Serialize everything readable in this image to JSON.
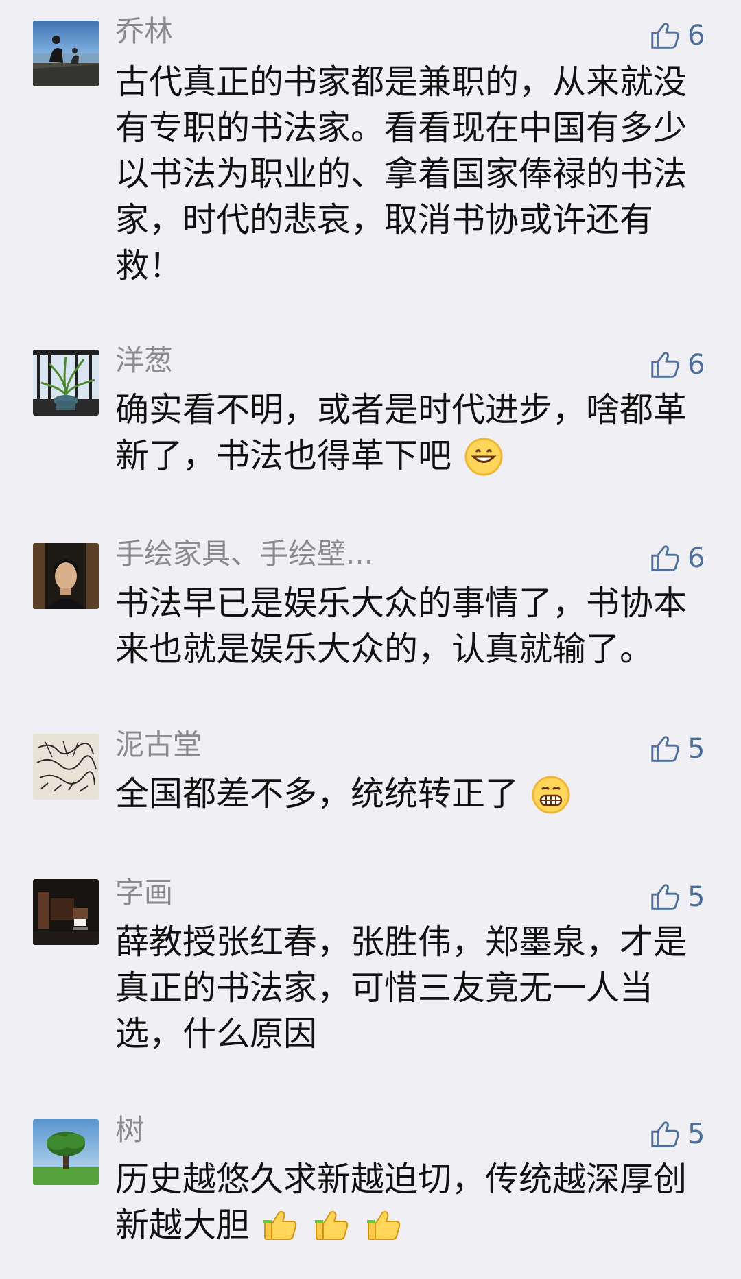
{
  "comments": [
    {
      "author": "乔林",
      "likes": "6",
      "text": "古代真正的书家都是兼职的，从来就没有专职的书法家。看看现在中国有多少以书法为职业的、拿着国家俸禄的书法家，时代的悲哀，取消书协或许还有救！",
      "avatar": "landscape-avatar"
    },
    {
      "author": "洋葱",
      "likes": "6",
      "text": "确实看不明，或者是时代进步，啥都革新了，书法也得革下吧",
      "emoji": "grinning-face",
      "avatar": "plant-avatar"
    },
    {
      "author": "手绘家具、手绘壁...",
      "likes": "6",
      "text": "书法早已是娱乐大众的事情了，书协本来也就是娱乐大众的，认真就输了。",
      "avatar": "portrait-avatar"
    },
    {
      "author": "泥古堂",
      "likes": "5",
      "text": "全国都差不多，统统转正了",
      "emoji": "beaming-face",
      "avatar": "calligraphy-avatar"
    },
    {
      "author": "字画",
      "likes": "5",
      "text": "薛教授张红春，张胜伟，郑墨泉，才是真正的书法家，可惜三友竟无一人当选，什么原因",
      "avatar": "interior-avatar"
    },
    {
      "author": "树",
      "likes": "5",
      "text": "历史越悠久求新越迫切，传统越深厚创新越大胆",
      "emoji": "thumbs-up-x3",
      "avatar": "tree-avatar"
    }
  ],
  "colors": {
    "background": "#efeff4",
    "name": "#8a8a8f",
    "like": "#4e6f98",
    "text": "#111111"
  }
}
